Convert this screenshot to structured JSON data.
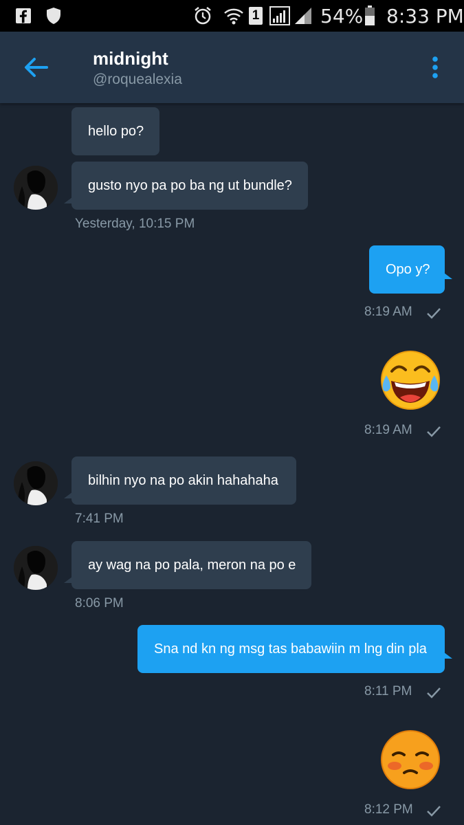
{
  "status_bar": {
    "battery": "54%",
    "time": "8:33 PM",
    "sim_slot": "1",
    "icons": [
      "facebook-icon",
      "shield-icon",
      "alarm-icon",
      "wifi-icon",
      "sim-1-icon",
      "signal-icon",
      "signal-icon-2",
      "battery-icon"
    ]
  },
  "header": {
    "title": "midnight",
    "handle": "@roquealexia",
    "back_icon": "arrow-left-icon",
    "menu_icon": "more-vertical-icon",
    "accent": "#1da1f2"
  },
  "messages": [
    {
      "from": "them",
      "text": "hello po?"
    },
    {
      "from": "them",
      "text": "gusto nyo pa po ba ng ut bundle?",
      "time": "Yesterday, 10:15 PM"
    },
    {
      "from": "me",
      "text": "Opo y?",
      "time": "8:19 AM"
    },
    {
      "from": "me",
      "emoji": "face-with-tears-of-joy",
      "time": "8:19 AM"
    },
    {
      "from": "them",
      "text": "bilhin nyo na po akin hahahaha",
      "time": "7:41 PM"
    },
    {
      "from": "them",
      "text": "ay wag na po pala, meron na po e",
      "time": "8:06 PM"
    },
    {
      "from": "me",
      "text": "Sna nd kn ng msg tas babawiin m lng din pla",
      "time": "8:11 PM"
    },
    {
      "from": "me",
      "emoji": "flushed-face",
      "time": "8:12 PM"
    }
  ]
}
